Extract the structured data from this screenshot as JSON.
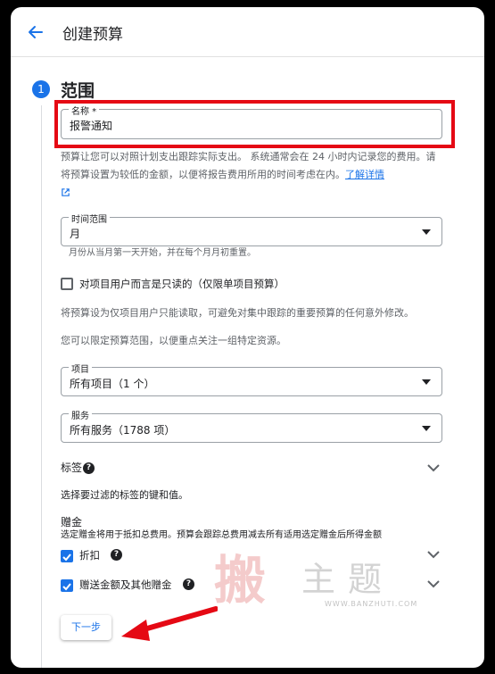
{
  "header": {
    "title": "创建预算"
  },
  "step": {
    "number": "1",
    "title": "范围"
  },
  "name_field": {
    "label": "名称 *",
    "value": "报警通知"
  },
  "budget_description": {
    "text": "预算让您可以对照计划支出跟踪实际支出。 系统通常会在 24 小时内记录您的费用。请将预算设置为较低的金额，以便将报告费用所用的时间考虑在内。",
    "learn_more": "了解详情"
  },
  "time_range": {
    "label": "时间范围",
    "value": "月",
    "hint": "月份从当月第一天开始，并在每个月月初重置。"
  },
  "readonly_checkbox": {
    "label": "对项目用户而言是只读的（仅限单项目预算）",
    "checked": false,
    "description": "将预算设为仅项目用户只能读取，可避免对集中跟踪的重要预算的任何意外修改。"
  },
  "scope_description": "您可以限定预算范围，以便重点关注一组特定资源。",
  "projects": {
    "label": "项目",
    "value": "所有项目（1 个）"
  },
  "services": {
    "label": "服务",
    "value": "所有服务（1788 项）"
  },
  "labels": {
    "title": "标签",
    "description": "选择要过滤的标签的键和值。"
  },
  "credits": {
    "title": "赠金",
    "description": "选定赠金将用于抵扣总费用。预算会跟踪总费用减去所有适用选定赠金后所得金额",
    "items": [
      {
        "label": "折扣",
        "checked": true
      },
      {
        "label": "赠送金额及其他赠金",
        "checked": true
      }
    ]
  },
  "next_button": {
    "label": "下一步"
  },
  "watermark": {
    "glyph": "搬",
    "text": "主题",
    "url": "WWW.BANZHUTI.COM"
  },
  "colors": {
    "accent": "#1a73e8",
    "highlight": "#e50914"
  }
}
